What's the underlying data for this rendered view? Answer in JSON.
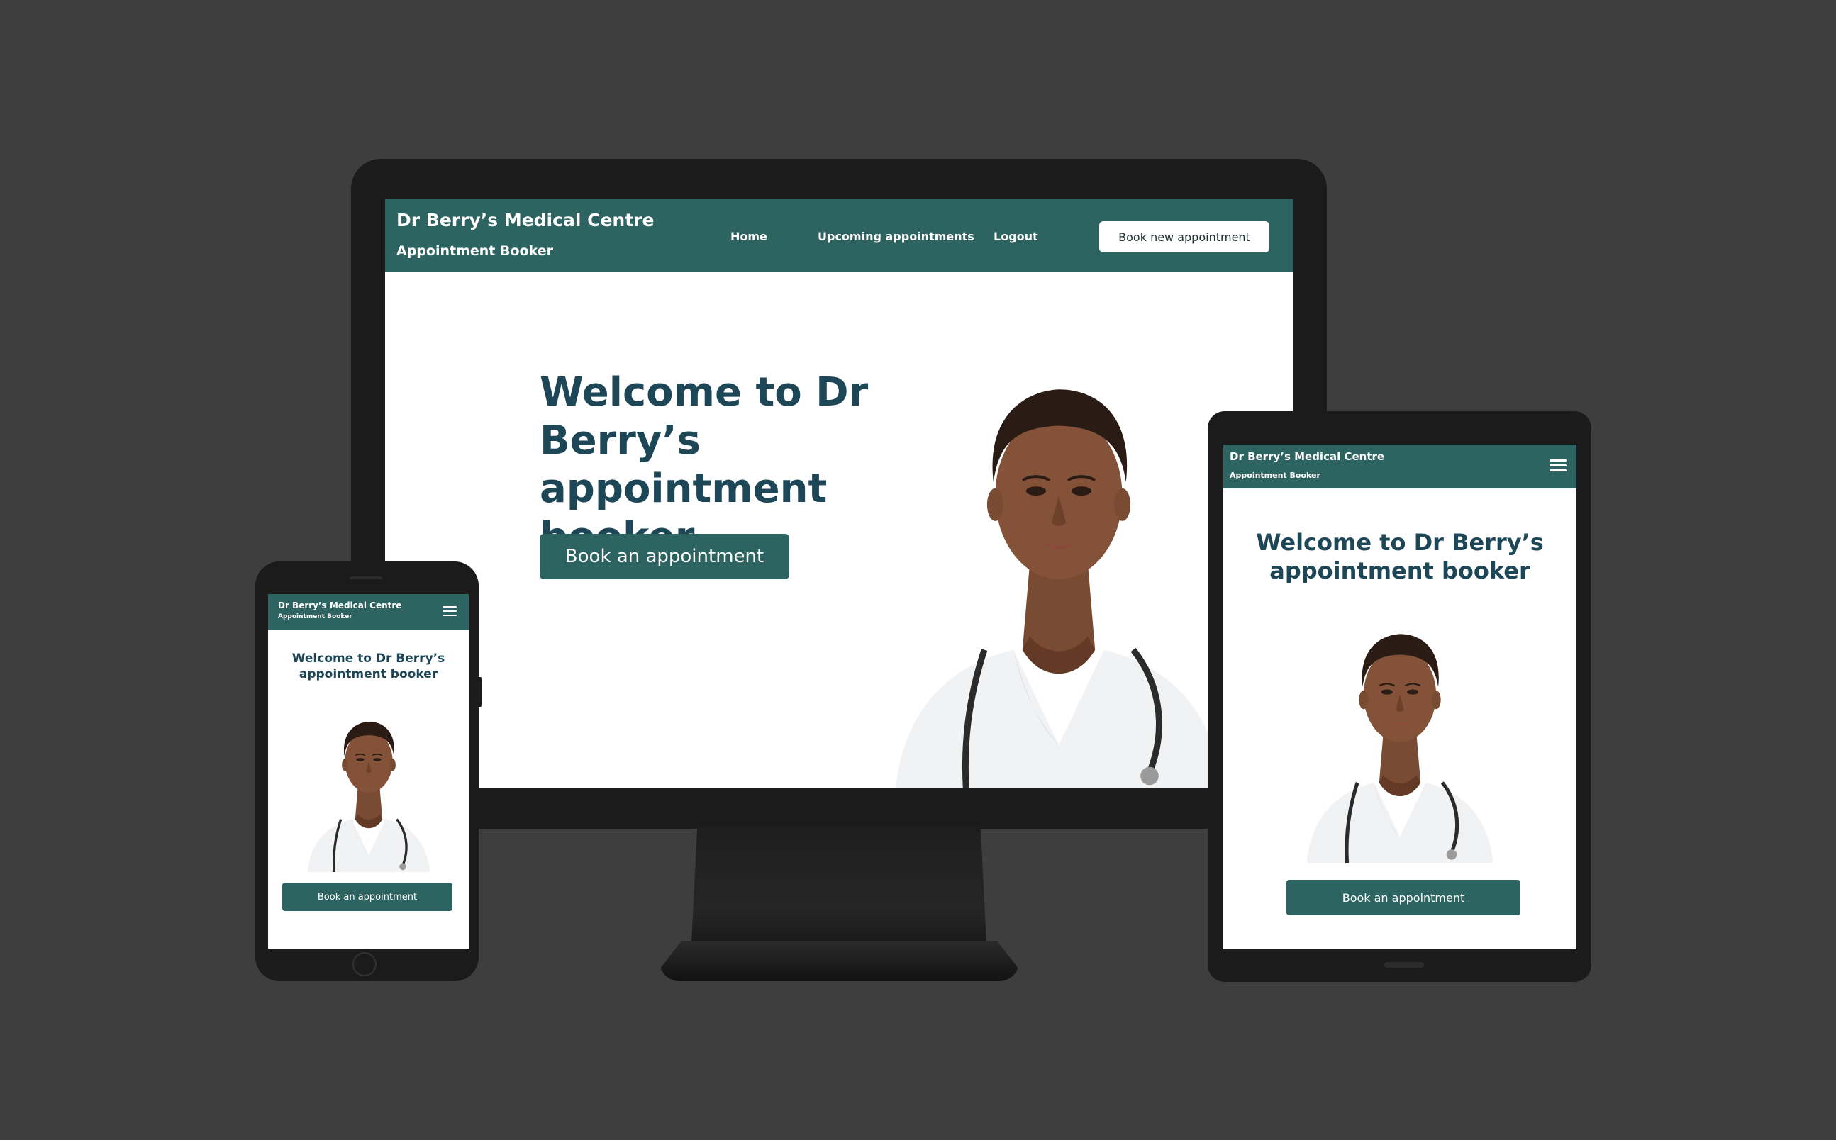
{
  "brand": {
    "name": "Dr Berry’s Medical Centre",
    "subtitle": "Appointment Booker"
  },
  "nav": {
    "items": [
      {
        "label": "Home"
      },
      {
        "label": "Upcoming appointments"
      },
      {
        "label": "Logout"
      }
    ],
    "cta_label": "Book new appointment"
  },
  "hero": {
    "title_line1": "Welcome to Dr Berry’s",
    "title_line2": "appointment booker",
    "button_label": "Book an appointment"
  },
  "icons": {
    "menu": "hamburger-menu-icon",
    "doctor_image": "doctor-portrait"
  },
  "colors": {
    "background": "#3e3e3e",
    "brand_teal": "#2d6360",
    "heading_navy": "#1d4657",
    "device_bezel": "#1b1b1b"
  }
}
